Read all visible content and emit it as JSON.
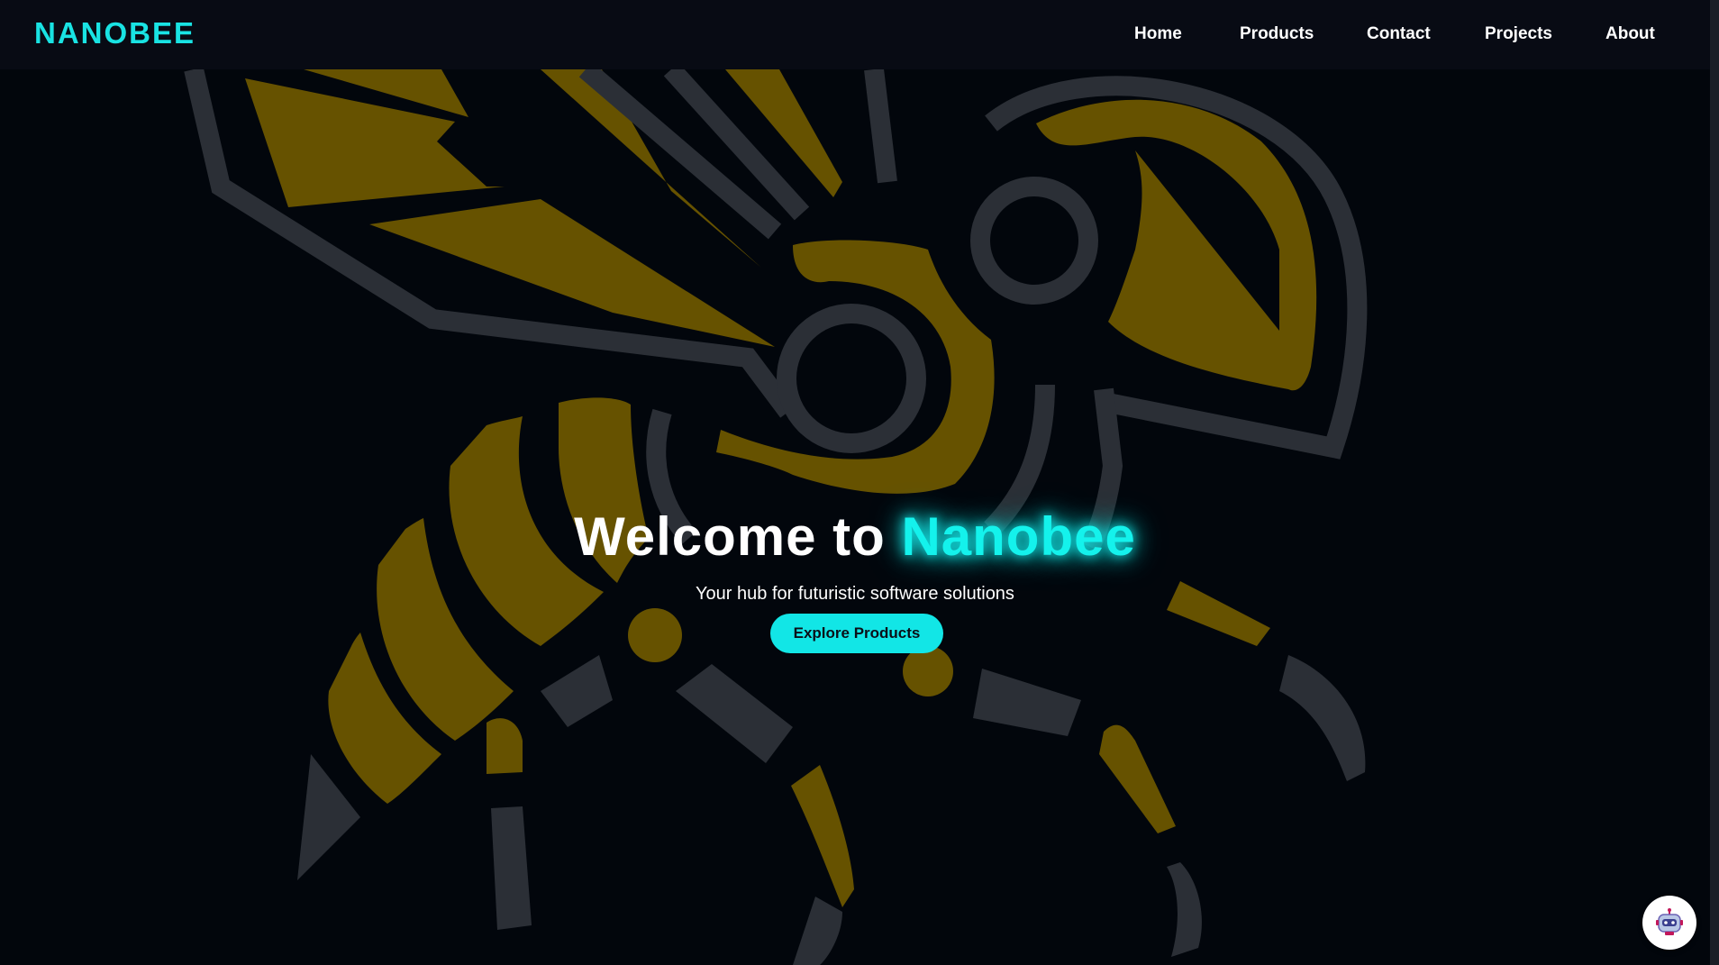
{
  "brand": {
    "logo_text": "NANOBEE"
  },
  "nav": {
    "items": [
      "Home",
      "Products",
      "Contact",
      "Projects",
      "About"
    ]
  },
  "hero": {
    "title_prefix": "Welcome to ",
    "title_accent": "Nanobee",
    "subtitle": "Your hub for futuristic software solutions",
    "cta_label": "Explore Products"
  },
  "background": {
    "illustration": "bee-illustration"
  },
  "chat": {
    "icon": "robot-icon"
  },
  "colors": {
    "accent": "#14f2ec",
    "navbar_bg": "#080b14",
    "page_bg": "#02060c",
    "bee_gold": "#665200",
    "bee_gray": "#2b2f36"
  }
}
